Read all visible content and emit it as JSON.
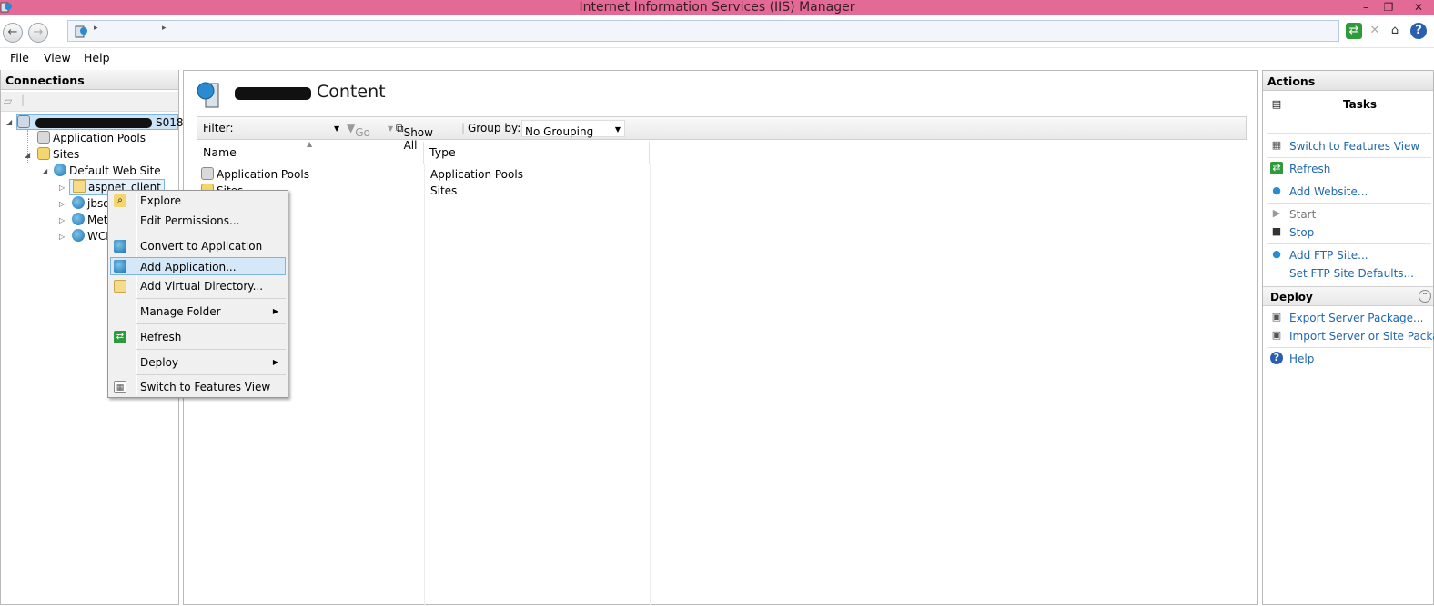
{
  "window": {
    "title": "Internet Information Services (IIS) Manager"
  },
  "menubar": {
    "file": "File",
    "view": "View",
    "help": "Help"
  },
  "connections": {
    "header": "Connections",
    "tree": {
      "app_pools": "Application Pools",
      "sites": "Sites",
      "default_site": "Default Web Site",
      "aspnet_client": "aspnet_client",
      "jbso": "jbso",
      "met": "Met",
      "wcl": "WCI",
      "server_suffix": "S018"
    }
  },
  "content": {
    "title_suffix": "Content",
    "filter_label": "Filter:",
    "go_label": "Go",
    "show_all_label": "Show All",
    "group_by_label": "Group by:",
    "group_by_value": "No Grouping",
    "columns": {
      "name": "Name",
      "type": "Type"
    },
    "rows": [
      {
        "name": "Application Pools",
        "type": "Application Pools"
      },
      {
        "name": "Sites",
        "type": "Sites"
      }
    ]
  },
  "context_menu": {
    "explore": "Explore",
    "edit_permissions": "Edit Permissions...",
    "convert_to_application": "Convert to Application",
    "add_application": "Add Application...",
    "add_virtual_directory": "Add Virtual Directory...",
    "manage_folder": "Manage Folder",
    "refresh": "Refresh",
    "deploy": "Deploy",
    "switch_features": "Switch to Features View"
  },
  "actions": {
    "header": "Actions",
    "tasks_label": "Tasks",
    "switch_features": "Switch to Features View",
    "refresh": "Refresh",
    "add_website": "Add Website...",
    "start": "Start",
    "stop": "Stop",
    "add_ftp": "Add FTP Site...",
    "ftp_defaults": "Set FTP Site Defaults...",
    "deploy_header": "Deploy",
    "export_package": "Export Server Package...",
    "import_package": "Import Server or Site Package",
    "help": "Help"
  },
  "colors": {
    "titlebar": "#e36a95",
    "link": "#2067b0",
    "highlight": "#d5e8f8"
  }
}
